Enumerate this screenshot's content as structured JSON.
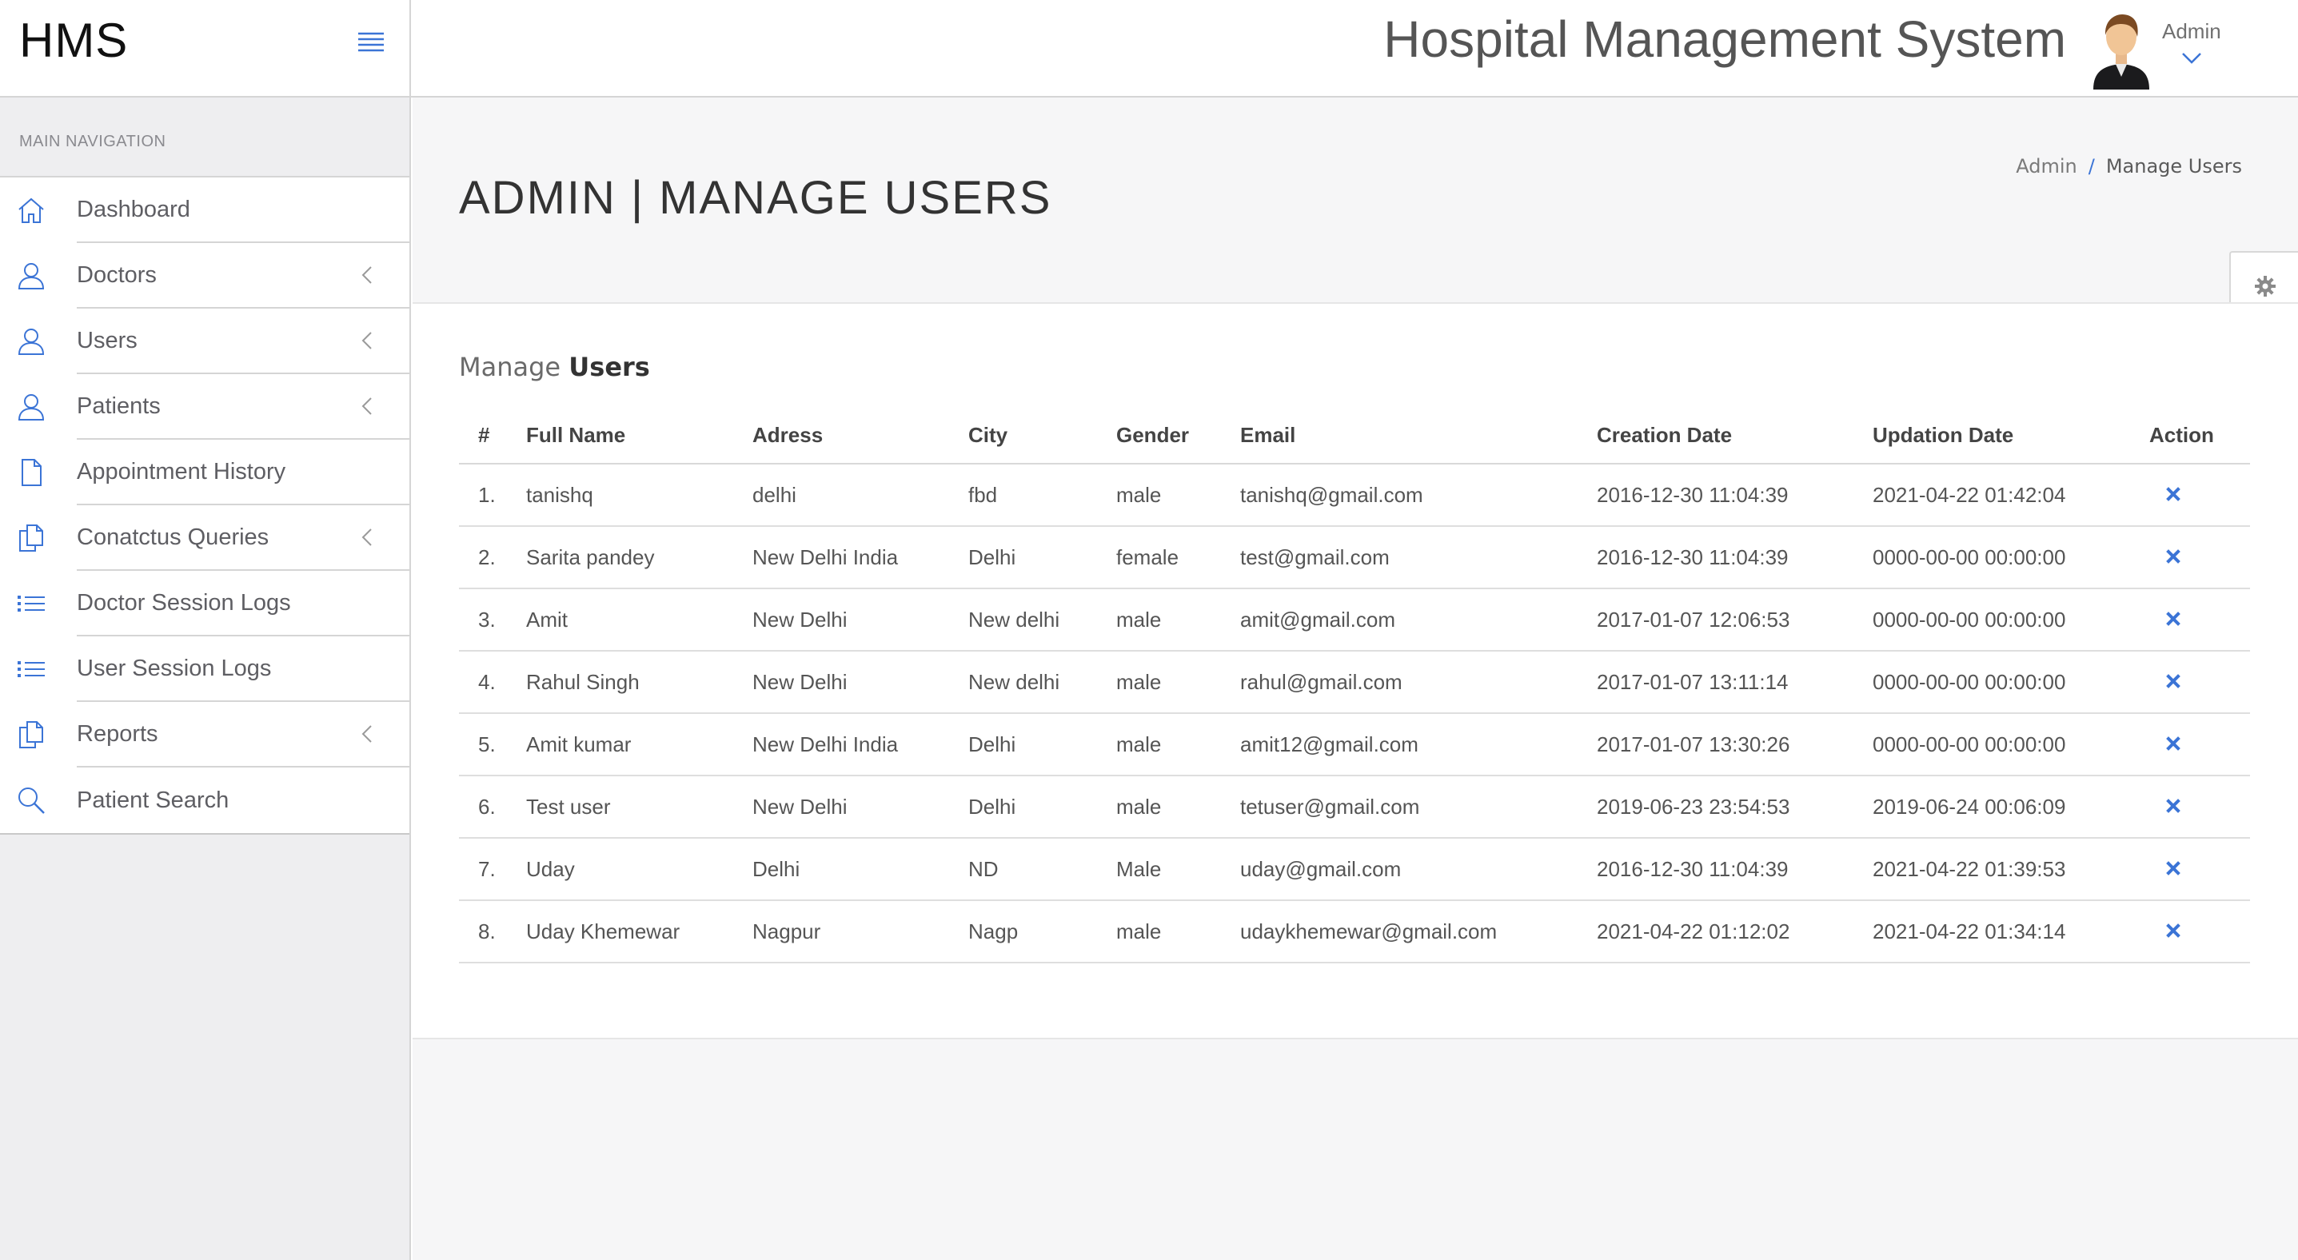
{
  "header": {
    "brand": "HMS",
    "app_title": "Hospital Management System",
    "user_name": "Admin"
  },
  "sidebar": {
    "heading": "MAIN NAVIGATION",
    "items": [
      {
        "label": "Dashboard",
        "icon": "home-icon",
        "submenu": false
      },
      {
        "label": "Doctors",
        "icon": "user-icon",
        "submenu": true
      },
      {
        "label": "Users",
        "icon": "user-icon",
        "submenu": true
      },
      {
        "label": "Patients",
        "icon": "user-icon",
        "submenu": true
      },
      {
        "label": "Appointment History",
        "icon": "file-icon",
        "submenu": false
      },
      {
        "label": "Conatctus Queries",
        "icon": "files-icon",
        "submenu": true
      },
      {
        "label": "Doctor Session Logs",
        "icon": "list-icon",
        "submenu": false
      },
      {
        "label": "User Session Logs",
        "icon": "list-icon",
        "submenu": false
      },
      {
        "label": "Reports",
        "icon": "files-icon",
        "submenu": true
      },
      {
        "label": "Patient Search",
        "icon": "search-icon",
        "submenu": false
      }
    ]
  },
  "page": {
    "title": "ADMIN | MANAGE USERS",
    "breadcrumb_root": "Admin",
    "breadcrumb_sep": "/",
    "breadcrumb_current": "Manage Users",
    "panel_title_light": "Manage",
    "panel_title_bold": "Users"
  },
  "table": {
    "columns": [
      "#",
      "Full Name",
      "Adress",
      "City",
      "Gender",
      "Email",
      "Creation Date",
      "Updation Date",
      "Action"
    ],
    "rows": [
      {
        "idx": "1.",
        "name": "tanishq",
        "address": "delhi",
        "city": "fbd",
        "gender": "male",
        "email": "tanishq@gmail.com",
        "created": "2016-12-30 11:04:39",
        "updated": "2021-04-22 01:42:04"
      },
      {
        "idx": "2.",
        "name": "Sarita pandey",
        "address": "New Delhi India",
        "city": "Delhi",
        "gender": "female",
        "email": "test@gmail.com",
        "created": "2016-12-30 11:04:39",
        "updated": "0000-00-00 00:00:00"
      },
      {
        "idx": "3.",
        "name": "Amit",
        "address": "New Delhi",
        "city": "New delhi",
        "gender": "male",
        "email": "amit@gmail.com",
        "created": "2017-01-07 12:06:53",
        "updated": "0000-00-00 00:00:00"
      },
      {
        "idx": "4.",
        "name": "Rahul Singh",
        "address": "New Delhi",
        "city": "New delhi",
        "gender": "male",
        "email": "rahul@gmail.com",
        "created": "2017-01-07 13:11:14",
        "updated": "0000-00-00 00:00:00"
      },
      {
        "idx": "5.",
        "name": "Amit kumar",
        "address": "New Delhi India",
        "city": "Delhi",
        "gender": "male",
        "email": "amit12@gmail.com",
        "created": "2017-01-07 13:30:26",
        "updated": "0000-00-00 00:00:00"
      },
      {
        "idx": "6.",
        "name": "Test user",
        "address": "New Delhi",
        "city": "Delhi",
        "gender": "male",
        "email": "tetuser@gmail.com",
        "created": "2019-06-23 23:54:53",
        "updated": "2019-06-24 00:06:09"
      },
      {
        "idx": "7.",
        "name": "Uday",
        "address": "Delhi",
        "city": "ND",
        "gender": "Male",
        "email": "uday@gmail.com",
        "created": "2016-12-30 11:04:39",
        "updated": "2021-04-22 01:39:53"
      },
      {
        "idx": "8.",
        "name": "Uday Khemewar",
        "address": "Nagpur",
        "city": "Nagp",
        "gender": "male",
        "email": "udaykhemewar@gmail.com",
        "created": "2021-04-22 01:12:02",
        "updated": "2021-04-22 01:34:14"
      }
    ],
    "action_icon": "delete-x-icon"
  },
  "colors": {
    "accent": "#3b74d6",
    "sidebar_bg": "#eeeef0",
    "main_bg": "#f6f6f7"
  }
}
